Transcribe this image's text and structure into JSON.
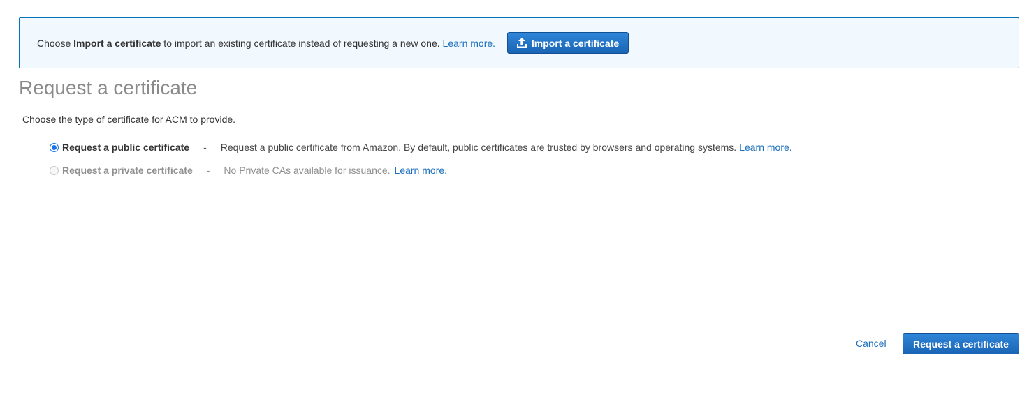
{
  "banner": {
    "prefix": "Choose ",
    "bold": "Import a certificate",
    "suffix": " to import an existing certificate instead of requesting a new one. ",
    "learn_more": "Learn more.",
    "import_button_label": "Import a certificate",
    "import_icon": "upload-icon"
  },
  "page": {
    "title": "Request a certificate",
    "subtitle": "Choose the type of certificate for ACM to provide."
  },
  "options": [
    {
      "label": "Request a public certificate",
      "separator": "-",
      "description": "Request a public certificate from Amazon. By default, public certificates are trusted by browsers and operating systems.",
      "learn_more": "Learn more.",
      "selected": true,
      "disabled": false
    },
    {
      "label": "Request a private certificate",
      "separator": "-",
      "description": "No Private CAs available for issuance.",
      "learn_more": "Learn more.",
      "selected": false,
      "disabled": true
    }
  ],
  "footer": {
    "cancel_label": "Cancel",
    "submit_label": "Request a certificate"
  },
  "colors": {
    "accent": "#1a64b5",
    "link": "#1b6fbe",
    "banner_bg": "#f1f8fe",
    "banner_border": "#0073bb"
  }
}
